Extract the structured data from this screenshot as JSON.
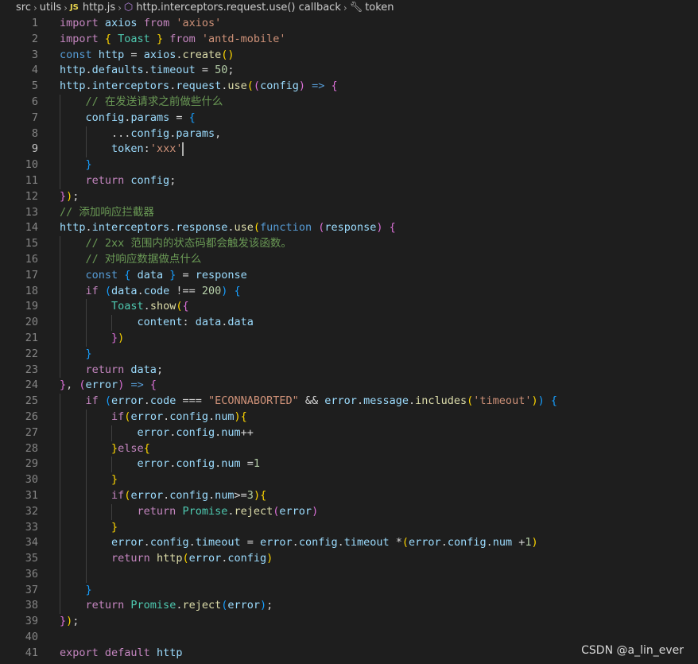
{
  "breadcrumb": {
    "items": [
      "src",
      "utils",
      "http.js",
      "http.interceptors.request.use() callback",
      "token"
    ],
    "js_badge": "JS"
  },
  "editor": {
    "language": "javascript",
    "active_line": 9,
    "lines": [
      [
        [
          "k",
          "import "
        ],
        [
          "v",
          "axios "
        ],
        [
          "k",
          "from "
        ],
        [
          "s",
          "'axios'"
        ]
      ],
      [
        [
          "k",
          "import "
        ],
        [
          "b1",
          "{ "
        ],
        [
          "t",
          "Toast "
        ],
        [
          "b1",
          "} "
        ],
        [
          "k",
          "from "
        ],
        [
          "s",
          "'antd-mobile'"
        ]
      ],
      [
        [
          "kb",
          "const "
        ],
        [
          "v",
          "http "
        ],
        [
          "p",
          "= "
        ],
        [
          "v",
          "axios"
        ],
        [
          "p",
          "."
        ],
        [
          "f",
          "create"
        ],
        [
          "b1",
          "()"
        ]
      ],
      [
        [
          "v",
          "http"
        ],
        [
          "p",
          "."
        ],
        [
          "v",
          "defaults"
        ],
        [
          "p",
          "."
        ],
        [
          "v",
          "timeout "
        ],
        [
          "p",
          "= "
        ],
        [
          "n",
          "50"
        ],
        [
          "p",
          ";"
        ]
      ],
      [
        [
          "v",
          "http"
        ],
        [
          "p",
          "."
        ],
        [
          "v",
          "interceptors"
        ],
        [
          "p",
          "."
        ],
        [
          "v",
          "request"
        ],
        [
          "p",
          "."
        ],
        [
          "f",
          "use"
        ],
        [
          "b1",
          "("
        ],
        [
          "b2",
          "("
        ],
        [
          "v",
          "config"
        ],
        [
          "b2",
          ") "
        ],
        [
          "kb",
          "=> "
        ],
        [
          "b2",
          "{"
        ]
      ],
      [
        [
          "p",
          "    "
        ],
        [
          "c",
          "// 在发送请求之前做些什么"
        ]
      ],
      [
        [
          "p",
          "    "
        ],
        [
          "v",
          "config"
        ],
        [
          "p",
          "."
        ],
        [
          "v",
          "params "
        ],
        [
          "p",
          "= "
        ],
        [
          "b3",
          "{"
        ]
      ],
      [
        [
          "p",
          "        ..."
        ],
        [
          "v",
          "config"
        ],
        [
          "p",
          "."
        ],
        [
          "v",
          "params"
        ],
        [
          "p",
          ","
        ]
      ],
      [
        [
          "p",
          "        "
        ],
        [
          "v",
          "token"
        ],
        [
          "p",
          ":"
        ],
        [
          "s",
          "'xxx'"
        ]
      ],
      [
        [
          "p",
          "    "
        ],
        [
          "b3",
          "}"
        ]
      ],
      [
        [
          "p",
          "    "
        ],
        [
          "k",
          "return "
        ],
        [
          "v",
          "config"
        ],
        [
          "p",
          ";"
        ]
      ],
      [
        [
          "b2",
          "}"
        ],
        [
          "b1",
          ")"
        ],
        [
          "p",
          ";"
        ]
      ],
      [
        [
          "c",
          "// 添加响应拦截器"
        ]
      ],
      [
        [
          "v",
          "http"
        ],
        [
          "p",
          "."
        ],
        [
          "v",
          "interceptors"
        ],
        [
          "p",
          "."
        ],
        [
          "v",
          "response"
        ],
        [
          "p",
          "."
        ],
        [
          "f",
          "use"
        ],
        [
          "b1",
          "("
        ],
        [
          "kb",
          "function "
        ],
        [
          "b2",
          "("
        ],
        [
          "v",
          "response"
        ],
        [
          "b2",
          ") "
        ],
        [
          "b2",
          "{"
        ]
      ],
      [
        [
          "p",
          "    "
        ],
        [
          "c",
          "// 2xx 范围内的状态码都会触发该函数。"
        ]
      ],
      [
        [
          "p",
          "    "
        ],
        [
          "c",
          "// 对响应数据做点什么"
        ]
      ],
      [
        [
          "p",
          "    "
        ],
        [
          "kb",
          "const "
        ],
        [
          "b3",
          "{ "
        ],
        [
          "v",
          "data "
        ],
        [
          "b3",
          "} "
        ],
        [
          "p",
          "= "
        ],
        [
          "v",
          "response"
        ]
      ],
      [
        [
          "p",
          "    "
        ],
        [
          "k",
          "if "
        ],
        [
          "b3",
          "("
        ],
        [
          "v",
          "data"
        ],
        [
          "p",
          "."
        ],
        [
          "v",
          "code "
        ],
        [
          "p",
          "!== "
        ],
        [
          "n",
          "200"
        ],
        [
          "b3",
          ") "
        ],
        [
          "b3",
          "{"
        ]
      ],
      [
        [
          "p",
          "        "
        ],
        [
          "t",
          "Toast"
        ],
        [
          "p",
          "."
        ],
        [
          "f",
          "show"
        ],
        [
          "b1",
          "("
        ],
        [
          "b2",
          "{"
        ]
      ],
      [
        [
          "p",
          "            "
        ],
        [
          "v",
          "content"
        ],
        [
          "p",
          ": "
        ],
        [
          "v",
          "data"
        ],
        [
          "p",
          "."
        ],
        [
          "v",
          "data"
        ]
      ],
      [
        [
          "p",
          "        "
        ],
        [
          "b2",
          "}"
        ],
        [
          "b1",
          ")"
        ]
      ],
      [
        [
          "p",
          "    "
        ],
        [
          "b3",
          "}"
        ]
      ],
      [
        [
          "p",
          "    "
        ],
        [
          "k",
          "return "
        ],
        [
          "v",
          "data"
        ],
        [
          "p",
          ";"
        ]
      ],
      [
        [
          "b2",
          "}"
        ],
        [
          "p",
          ", "
        ],
        [
          "b2",
          "("
        ],
        [
          "v",
          "error"
        ],
        [
          "b2",
          ") "
        ],
        [
          "kb",
          "=> "
        ],
        [
          "b2",
          "{"
        ]
      ],
      [
        [
          "p",
          "    "
        ],
        [
          "k",
          "if "
        ],
        [
          "b3",
          "("
        ],
        [
          "v",
          "error"
        ],
        [
          "p",
          "."
        ],
        [
          "v",
          "code "
        ],
        [
          "p",
          "=== "
        ],
        [
          "s",
          "\"ECONNABORTED\" "
        ],
        [
          "p",
          "&& "
        ],
        [
          "v",
          "error"
        ],
        [
          "p",
          "."
        ],
        [
          "v",
          "message"
        ],
        [
          "p",
          "."
        ],
        [
          "f",
          "includes"
        ],
        [
          "b1",
          "("
        ],
        [
          "s",
          "'timeout'"
        ],
        [
          "b1",
          ")"
        ],
        [
          "b3",
          ") "
        ],
        [
          "b3",
          "{"
        ]
      ],
      [
        [
          "p",
          "        "
        ],
        [
          "k",
          "if"
        ],
        [
          "b1",
          "("
        ],
        [
          "v",
          "error"
        ],
        [
          "p",
          "."
        ],
        [
          "v",
          "config"
        ],
        [
          "p",
          "."
        ],
        [
          "v",
          "num"
        ],
        [
          "b1",
          ")"
        ],
        [
          "b1",
          "{"
        ]
      ],
      [
        [
          "p",
          "            "
        ],
        [
          "v",
          "error"
        ],
        [
          "p",
          "."
        ],
        [
          "v",
          "config"
        ],
        [
          "p",
          "."
        ],
        [
          "v",
          "num"
        ],
        [
          "p",
          "++"
        ]
      ],
      [
        [
          "p",
          "        "
        ],
        [
          "b1",
          "}"
        ],
        [
          "k",
          "else"
        ],
        [
          "b1",
          "{"
        ]
      ],
      [
        [
          "p",
          "            "
        ],
        [
          "v",
          "error"
        ],
        [
          "p",
          "."
        ],
        [
          "v",
          "config"
        ],
        [
          "p",
          "."
        ],
        [
          "v",
          "num "
        ],
        [
          "p",
          "="
        ],
        [
          "n",
          "1"
        ]
      ],
      [
        [
          "p",
          "        "
        ],
        [
          "b1",
          "}"
        ]
      ],
      [
        [
          "p",
          "        "
        ],
        [
          "k",
          "if"
        ],
        [
          "b1",
          "("
        ],
        [
          "v",
          "error"
        ],
        [
          "p",
          "."
        ],
        [
          "v",
          "config"
        ],
        [
          "p",
          "."
        ],
        [
          "v",
          "num"
        ],
        [
          "p",
          ">="
        ],
        [
          "n",
          "3"
        ],
        [
          "b1",
          ")"
        ],
        [
          "b1",
          "{"
        ]
      ],
      [
        [
          "p",
          "            "
        ],
        [
          "k",
          "return "
        ],
        [
          "t",
          "Promise"
        ],
        [
          "p",
          "."
        ],
        [
          "f",
          "reject"
        ],
        [
          "b2",
          "("
        ],
        [
          "v",
          "error"
        ],
        [
          "b2",
          ")"
        ]
      ],
      [
        [
          "p",
          "        "
        ],
        [
          "b1",
          "}"
        ]
      ],
      [
        [
          "p",
          "        "
        ],
        [
          "v",
          "error"
        ],
        [
          "p",
          "."
        ],
        [
          "v",
          "config"
        ],
        [
          "p",
          "."
        ],
        [
          "v",
          "timeout "
        ],
        [
          "p",
          "= "
        ],
        [
          "v",
          "error"
        ],
        [
          "p",
          "."
        ],
        [
          "v",
          "config"
        ],
        [
          "p",
          "."
        ],
        [
          "v",
          "timeout "
        ],
        [
          "p",
          "*"
        ],
        [
          "b1",
          "("
        ],
        [
          "v",
          "error"
        ],
        [
          "p",
          "."
        ],
        [
          "v",
          "config"
        ],
        [
          "p",
          "."
        ],
        [
          "v",
          "num "
        ],
        [
          "p",
          "+"
        ],
        [
          "n",
          "1"
        ],
        [
          "b1",
          ")"
        ]
      ],
      [
        [
          "p",
          "        "
        ],
        [
          "k",
          "return "
        ],
        [
          "f",
          "http"
        ],
        [
          "b1",
          "("
        ],
        [
          "v",
          "error"
        ],
        [
          "p",
          "."
        ],
        [
          "v",
          "config"
        ],
        [
          "b1",
          ")"
        ]
      ],
      [],
      [
        [
          "p",
          "    "
        ],
        [
          "b3",
          "}"
        ]
      ],
      [
        [
          "p",
          "    "
        ],
        [
          "k",
          "return "
        ],
        [
          "t",
          "Promise"
        ],
        [
          "p",
          "."
        ],
        [
          "f",
          "reject"
        ],
        [
          "b3",
          "("
        ],
        [
          "v",
          "error"
        ],
        [
          "b3",
          ")"
        ],
        [
          "p",
          ";"
        ]
      ],
      [
        [
          "b2",
          "}"
        ],
        [
          "b1",
          ")"
        ],
        [
          "p",
          ";"
        ]
      ],
      [],
      [
        [
          "k",
          "export "
        ],
        [
          "k",
          "default "
        ],
        [
          "v",
          "http"
        ]
      ]
    ],
    "guides": [
      [],
      [],
      [],
      [],
      [],
      [
        1
      ],
      [
        1
      ],
      [
        1,
        2
      ],
      [
        1,
        2
      ],
      [
        1
      ],
      [
        1
      ],
      [],
      [],
      [],
      [
        1
      ],
      [
        1
      ],
      [
        1
      ],
      [
        1
      ],
      [
        1,
        2
      ],
      [
        1,
        2,
        3
      ],
      [
        1,
        2
      ],
      [
        1
      ],
      [
        1
      ],
      [],
      [
        1
      ],
      [
        1,
        2
      ],
      [
        1,
        2,
        3
      ],
      [
        1,
        2
      ],
      [
        1,
        2,
        3
      ],
      [
        1,
        2
      ],
      [
        1,
        2
      ],
      [
        1,
        2,
        3
      ],
      [
        1,
        2
      ],
      [
        1,
        2
      ],
      [
        1,
        2
      ],
      [
        1,
        2
      ],
      [
        1
      ],
      [
        1
      ],
      [],
      [],
      []
    ]
  },
  "watermark": "CSDN @a_lin_ever"
}
